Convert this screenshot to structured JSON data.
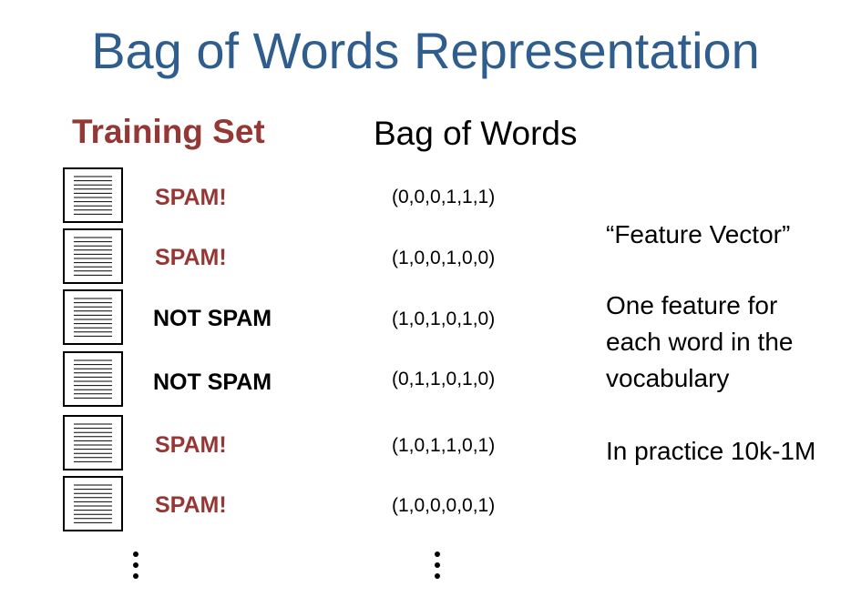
{
  "title": "Bag of Words Representation",
  "headings": {
    "training_set": "Training Set",
    "bag_of_words": "Bag of Words"
  },
  "rows": [
    {
      "label": "SPAM!",
      "vector": "(0,0,0,1,1,1)"
    },
    {
      "label": "SPAM!",
      "vector": "(1,0,0,1,0,0)"
    },
    {
      "label": "NOT SPAM",
      "vector": "(1,0,1,0,1,0)"
    },
    {
      "label": "NOT SPAM",
      "vector": "(0,1,1,0,1,0)"
    },
    {
      "label": "SPAM!",
      "vector": "(1,0,1,1,0,1)"
    },
    {
      "label": "SPAM!",
      "vector": "(1,0,0,0,0,1)"
    }
  ],
  "notes": {
    "feature_vector": "“Feature Vector”",
    "one_feature_line1": "One feature for",
    "one_feature_line2": "each word in the",
    "one_feature_line3": "vocabulary",
    "in_practice": "In practice 10k-1M"
  },
  "colors": {
    "title": "#2e5d8e",
    "spam": "#953735",
    "not_spam": "#000000"
  },
  "icons": {
    "document": "document-icon",
    "more": "vertical-ellipsis-icon"
  }
}
